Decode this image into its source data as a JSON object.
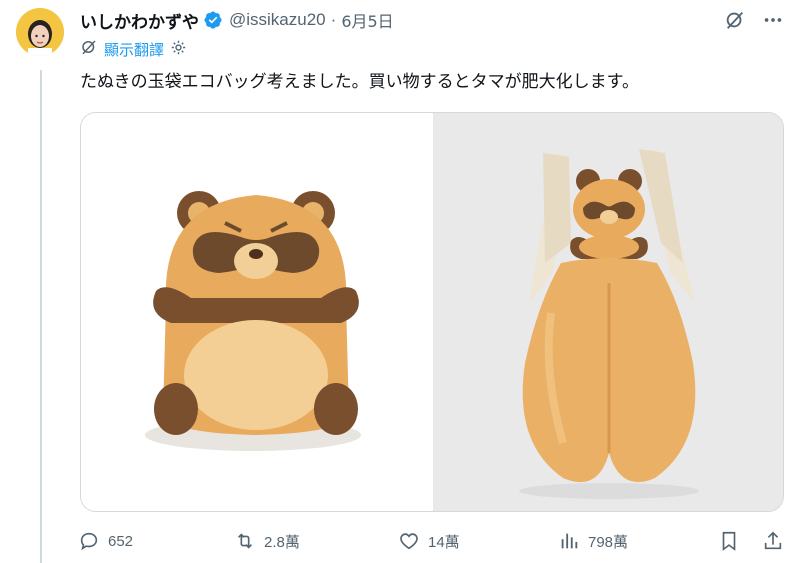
{
  "author": {
    "display_name": "いしかわかずや",
    "handle": "@issikazu20",
    "separator": "·",
    "date": "6月5日",
    "verified": true
  },
  "translate": {
    "label": "顯示翻譯"
  },
  "post": {
    "text": "たぬきの玉袋エコバッグ考えました。買い物するとタマが肥大化します。"
  },
  "media": {
    "count": 2
  },
  "actions": {
    "reply_count": "652",
    "retweet_count": "2.8萬",
    "like_count": "14萬",
    "view_count": "798萬"
  },
  "colors": {
    "accent": "#1d9bf0",
    "muted": "#536471",
    "text": "#0f1419",
    "border": "#cfd9de"
  },
  "icons": {
    "verified": "verified-badge-icon",
    "grok": "grok-icon",
    "more": "more-icon",
    "translate": "translate-icon",
    "settings": "gear-icon",
    "reply": "reply-icon",
    "retweet": "retweet-icon",
    "like": "heart-icon",
    "views": "views-icon",
    "bookmark": "bookmark-icon",
    "share": "share-icon"
  }
}
